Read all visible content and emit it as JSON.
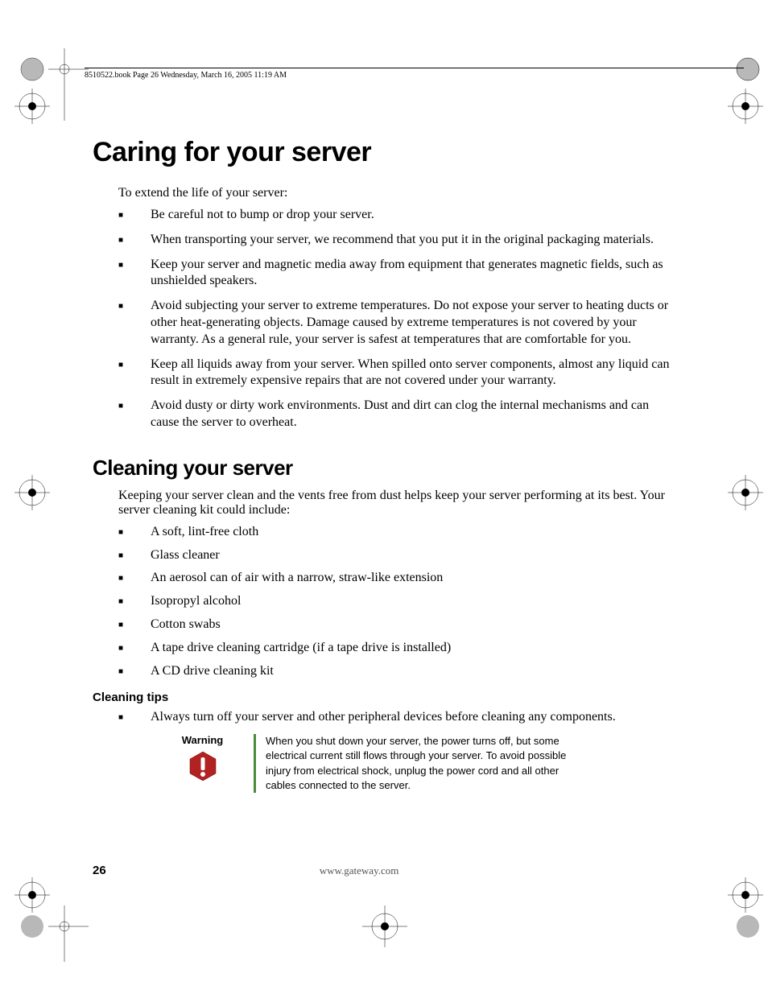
{
  "header": "8510522.book  Page 26  Wednesday, March 16, 2005  11:19 AM",
  "title": "Caring for your server",
  "intro1": "To extend the life of your server:",
  "care_bullets": [
    "Be careful not to bump or drop your server.",
    "When transporting your server, we recommend that you put it in the original packaging materials.",
    "Keep your server and magnetic media away from equipment that generates magnetic fields, such as unshielded speakers.",
    "Avoid subjecting your server to extreme temperatures. Do not expose your server to heating ducts or other heat-generating objects. Damage caused by extreme temperatures is not covered by your warranty. As a general rule, your server is safest at temperatures that are comfortable for you.",
    "Keep all liquids away from your server. When spilled onto server components, almost any liquid can result in extremely expensive repairs that are not covered under your warranty.",
    "Avoid dusty or dirty work environments. Dust and dirt can clog the internal mechanisms and can cause the server to overheat."
  ],
  "h2": "Cleaning your server",
  "intro2": "Keeping your server clean and the vents free from dust helps keep your server performing at its best. Your server cleaning kit could include:",
  "kit_bullets": [
    "A soft, lint-free cloth",
    "Glass cleaner",
    "An aerosol can of air with a narrow, straw-like extension",
    "Isopropyl alcohol",
    "Cotton swabs",
    "A tape drive cleaning cartridge (if a tape drive is installed)",
    "A CD drive cleaning kit"
  ],
  "h3": "Cleaning tips",
  "tips_bullets": [
    "Always turn off your server and other peripheral devices before cleaning any components."
  ],
  "warning": {
    "label": "Warning",
    "text": "When you shut down your server, the power turns off, but some electrical current still flows through your server. To avoid possible injury from electrical shock, unplug the power cord and all other cables connected to the server."
  },
  "page_number": "26",
  "footer_url": "www.gateway.com"
}
